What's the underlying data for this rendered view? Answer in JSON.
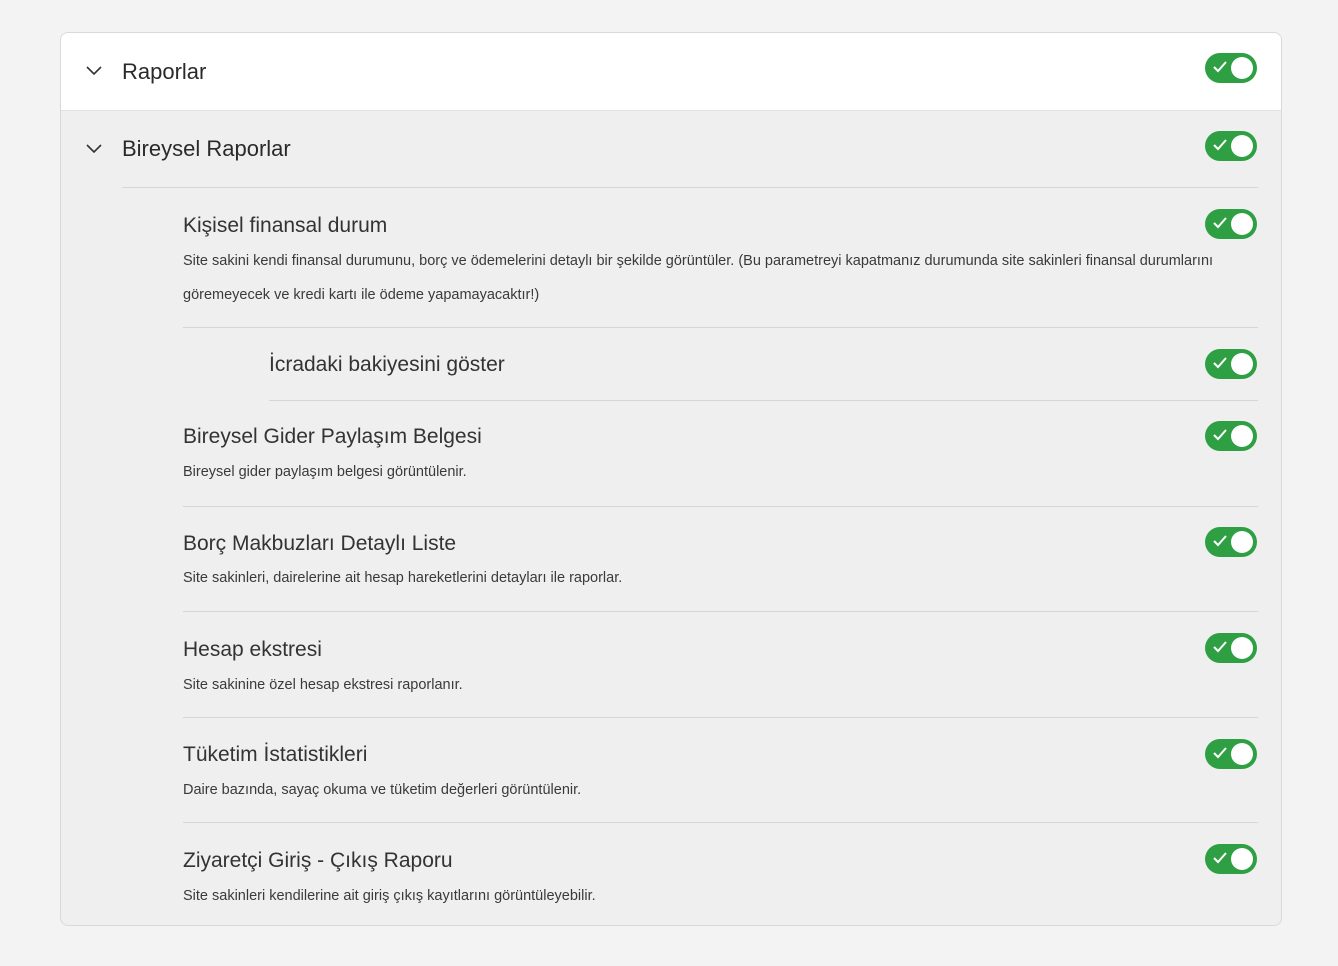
{
  "sections": {
    "raporlar": {
      "title": "Raporlar",
      "enabled": true
    },
    "bireysel": {
      "title": "Bireysel Raporlar",
      "enabled": true
    }
  },
  "items": [
    {
      "title": "Kişisel finansal durum",
      "description": "Site sakini kendi finansal durumunu, borç ve ödemelerini detaylı bir şekilde görüntüler. (Bu parametreyi kapatmanız durumunda site sakinleri finansal durumlarını göremeyecek ve kredi kartı ile ödeme yapamayacaktır!)",
      "enabled": true
    },
    {
      "title": "İcradaki bakiyesini göster",
      "description": "",
      "enabled": true
    },
    {
      "title": "Bireysel Gider Paylaşım Belgesi",
      "description": "Bireysel gider paylaşım belgesi görüntülenir.",
      "enabled": true
    },
    {
      "title": "Borç Makbuzları Detaylı Liste",
      "description": "Site sakinleri, dairelerine ait hesap hareketlerini detayları ile raporlar.",
      "enabled": true
    },
    {
      "title": "Hesap ekstresi",
      "description": "Site sakinine özel hesap ekstresi raporlanır.",
      "enabled": true
    },
    {
      "title": "Tüketim İstatistikleri",
      "description": "Daire bazında, sayaç okuma ve tüketim değerleri görüntülenir.",
      "enabled": true
    },
    {
      "title": "Ziyaretçi Giriş - Çıkış Raporu",
      "description": "Site sakinleri kendilerine ait giriş çıkış kayıtlarını görüntüleyebilir.",
      "enabled": true
    }
  ],
  "colors": {
    "toggle_on": "#2ea043",
    "card_bg": "#efefef",
    "header_bg": "#ffffff"
  },
  "icons": {
    "expand": "chevron-down-icon",
    "toggle_check": "check-icon"
  }
}
